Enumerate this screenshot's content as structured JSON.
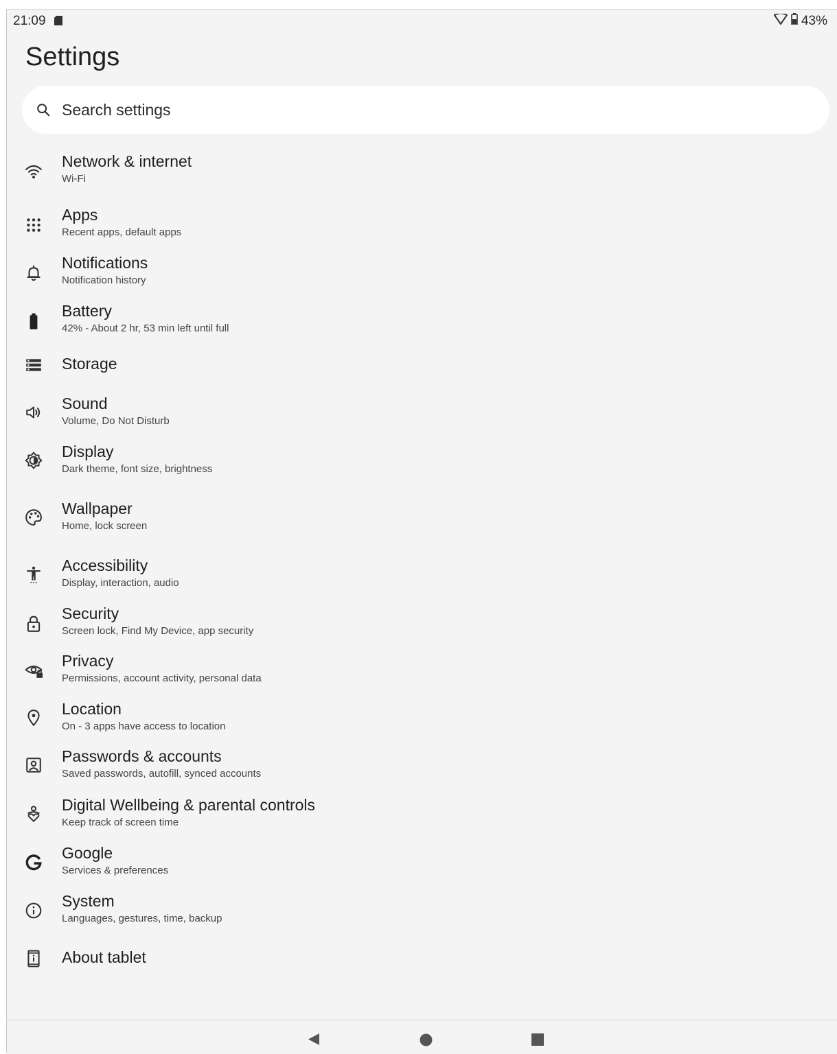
{
  "status_bar": {
    "time": "21:09",
    "battery_percent": "43%"
  },
  "page": {
    "title": "Settings"
  },
  "search": {
    "placeholder": "Search settings",
    "value": ""
  },
  "items": [
    {
      "id": "network",
      "title": "Network & internet",
      "summary": "Wi-Fi",
      "icon": "wifi-icon"
    },
    {
      "id": "apps",
      "title": "Apps",
      "summary": "Recent apps, default apps",
      "icon": "apps-grid-icon"
    },
    {
      "id": "notifications",
      "title": "Notifications",
      "summary": "Notification history",
      "icon": "bell-icon"
    },
    {
      "id": "battery",
      "title": "Battery",
      "summary": "42% - About 2 hr, 53 min left until full",
      "icon": "battery-icon"
    },
    {
      "id": "storage",
      "title": "Storage",
      "summary": "",
      "icon": "storage-icon"
    },
    {
      "id": "sound",
      "title": "Sound",
      "summary": "Volume, Do Not Disturb",
      "icon": "speaker-icon"
    },
    {
      "id": "display",
      "title": "Display",
      "summary": "Dark theme, font size, brightness",
      "icon": "brightness-icon"
    },
    {
      "id": "wallpaper",
      "title": "Wallpaper",
      "summary": "Home, lock screen",
      "icon": "palette-icon"
    },
    {
      "id": "accessibility",
      "title": "Accessibility",
      "summary": "Display, interaction, audio",
      "icon": "accessibility-icon"
    },
    {
      "id": "security",
      "title": "Security",
      "summary": "Screen lock, Find My Device, app security",
      "icon": "lock-icon"
    },
    {
      "id": "privacy",
      "title": "Privacy",
      "summary": "Permissions, account activity, personal data",
      "icon": "eye-lock-icon"
    },
    {
      "id": "location",
      "title": "Location",
      "summary": "On - 3 apps have access to location",
      "icon": "location-pin-icon"
    },
    {
      "id": "accounts",
      "title": "Passwords & accounts",
      "summary": "Saved passwords, autofill, synced accounts",
      "icon": "account-box-icon"
    },
    {
      "id": "wellbeing",
      "title": "Digital Wellbeing & parental controls",
      "summary": "Keep track of screen time",
      "icon": "wellbeing-icon"
    },
    {
      "id": "google",
      "title": "Google",
      "summary": "Services & preferences",
      "icon": "google-g-icon"
    },
    {
      "id": "system",
      "title": "System",
      "summary": "Languages, gestures, time, backup",
      "icon": "info-icon"
    },
    {
      "id": "about",
      "title": "About tablet",
      "summary": "",
      "icon": "tablet-info-icon"
    }
  ],
  "nav_bar": {
    "back": "back-icon",
    "home": "home-icon",
    "recents": "recents-icon"
  }
}
